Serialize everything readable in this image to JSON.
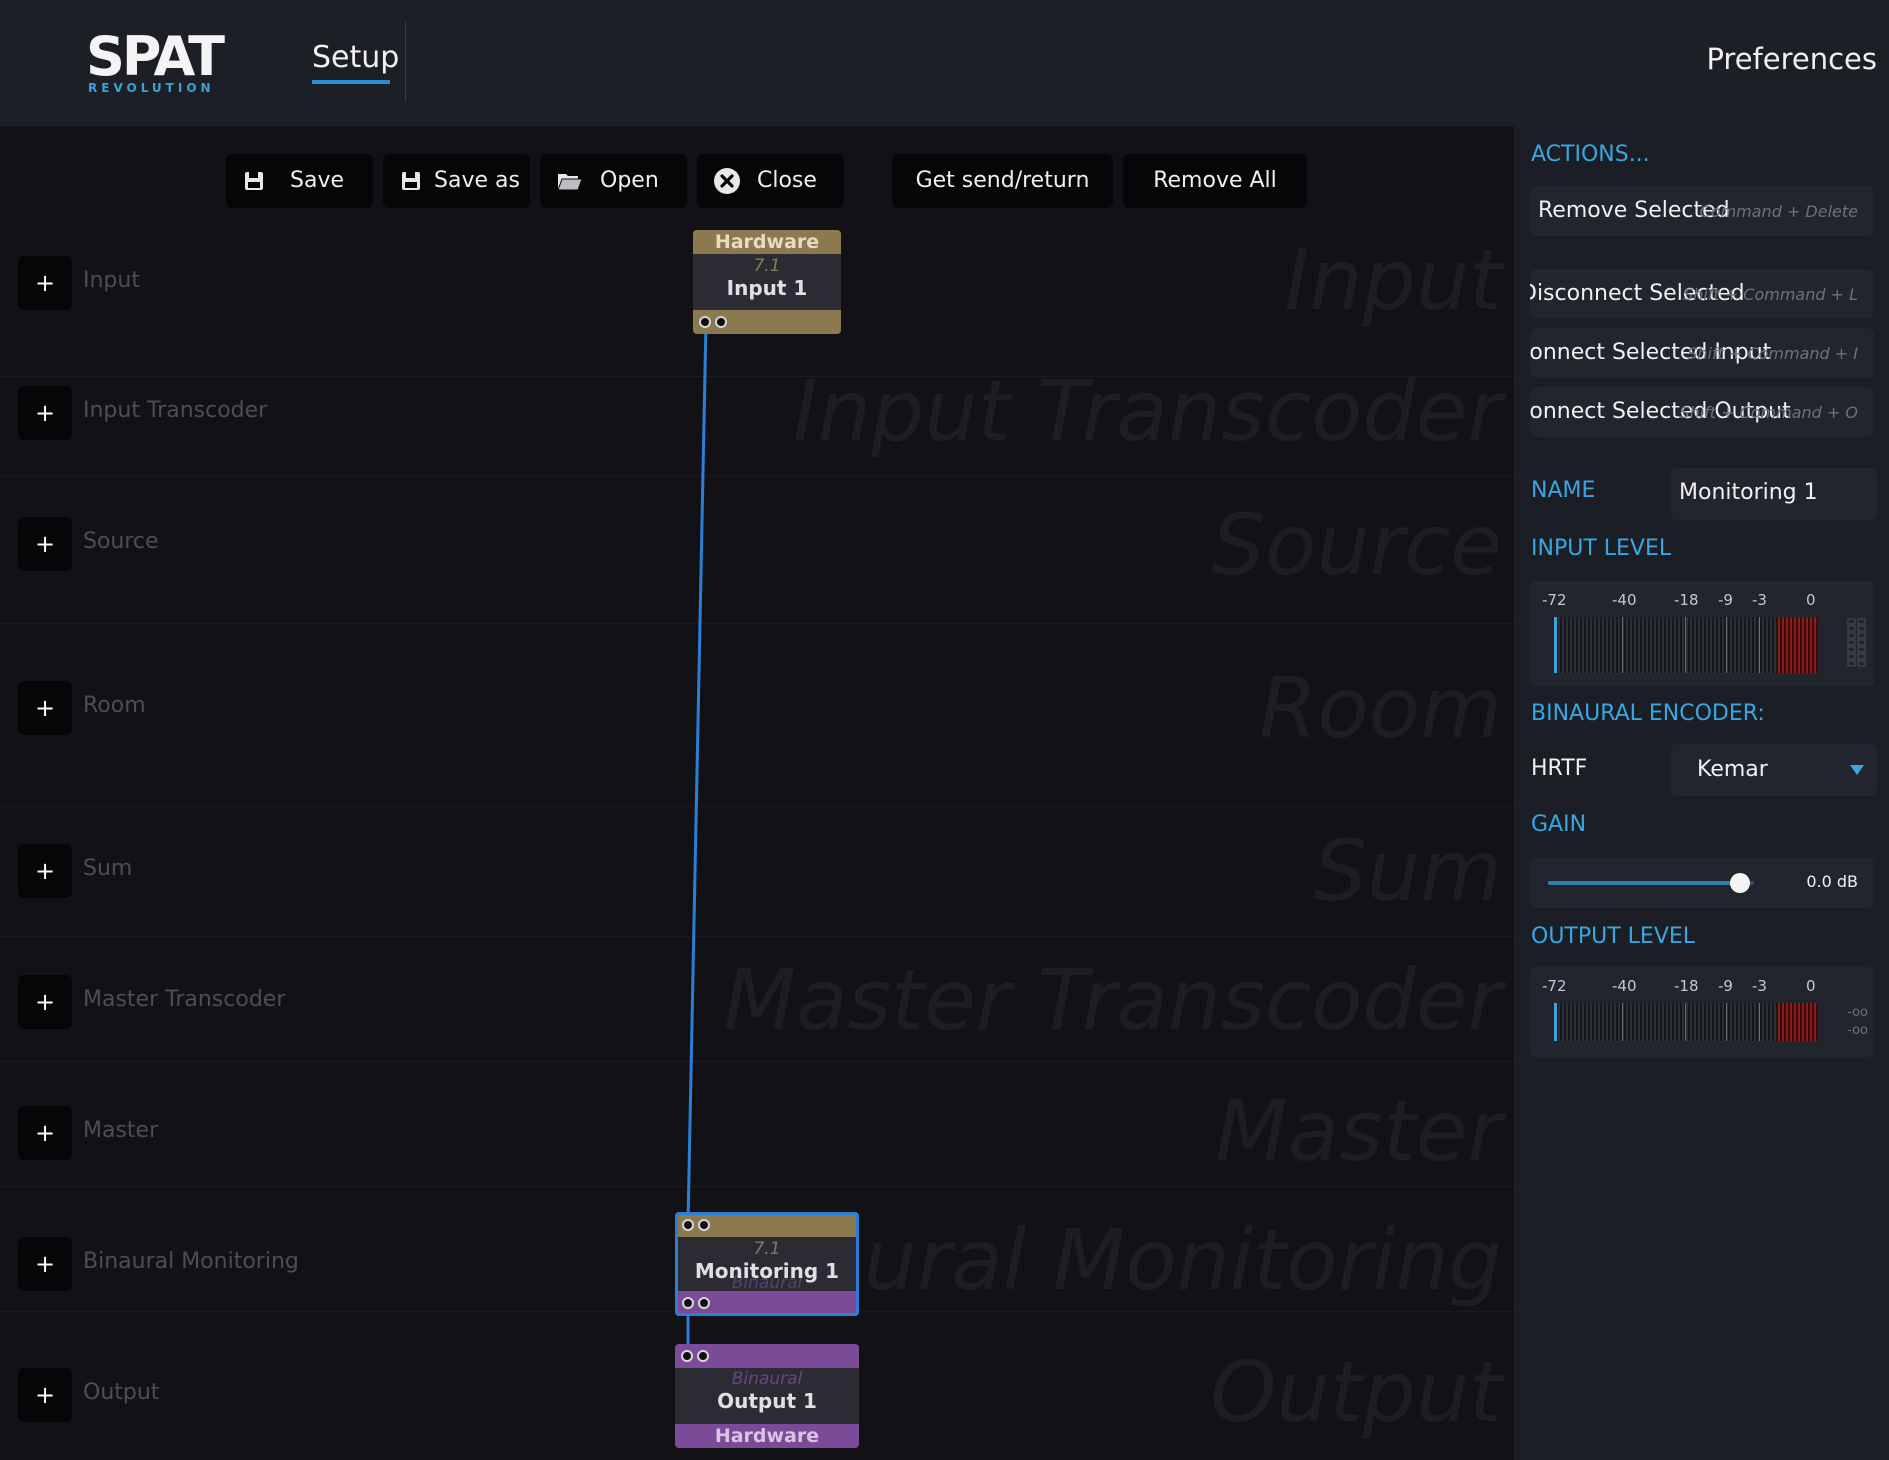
{
  "app": {
    "logo_main": "SPAT",
    "logo_sub": "REVOLUTION",
    "tab_setup": "Setup",
    "preferences": "Preferences"
  },
  "toolbar": {
    "save": "Save",
    "save_as": "Save as",
    "open": "Open",
    "close": "Close",
    "get_send_return": "Get send/return",
    "remove_all": "Remove All"
  },
  "rows": [
    {
      "label": "Input",
      "watermark": "Input"
    },
    {
      "label": "Input Transcoder",
      "watermark": "Input Transcoder"
    },
    {
      "label": "Source",
      "watermark": "Source"
    },
    {
      "label": "Room",
      "watermark": "Room"
    },
    {
      "label": "Sum",
      "watermark": "Sum"
    },
    {
      "label": "Master Transcoder",
      "watermark": "Master Transcoder"
    },
    {
      "label": "Master",
      "watermark": "Master"
    },
    {
      "label": "Binaural Monitoring",
      "watermark": "Binaural Monitoring"
    },
    {
      "label": "Output",
      "watermark": "Output"
    }
  ],
  "add_symbol": "+",
  "nodes": {
    "input": {
      "top": "Hardware",
      "format": "7.1",
      "name": "Input 1"
    },
    "monitoring": {
      "format": "7.1",
      "name": "Monitoring 1",
      "ghost": "Binaural"
    },
    "output": {
      "format": "Binaural",
      "name": "Output 1",
      "bottom": "Hardware"
    }
  },
  "panel": {
    "actions_title": "ACTIONS...",
    "actions": [
      {
        "label": "Remove Selected",
        "shortcut": "Command + Delete"
      },
      {
        "label": "Disconnect Selected",
        "shortcut": "Shift + Command + L"
      },
      {
        "label": "Connect Selected Input",
        "shortcut": "Shift + Command + I"
      },
      {
        "label": "Connect Selected Output",
        "shortcut": "Shift + Command + O"
      }
    ],
    "name_label": "NAME",
    "name_value": "Monitoring 1",
    "input_level_label": "INPUT LEVEL",
    "meter_scale": [
      "-72",
      "-40",
      "-18",
      "-9",
      "-3",
      "0"
    ],
    "binaural_encoder_label": "BINAURAL ENCODER:",
    "hrtf_label": "HRTF",
    "hrtf_value": "Kemar",
    "gain_label": "GAIN",
    "gain_value": "0.0 dB",
    "gain_fraction": 0.93,
    "output_level_label": "OUTPUT LEVEL",
    "output_readouts": [
      "-oo",
      "-oo"
    ]
  },
  "colors": {
    "accent": "#3aa6e0",
    "hardware_band": "#8b7a4f",
    "binaural_band": "#7b4a98",
    "connection": "#2b7fd6"
  }
}
